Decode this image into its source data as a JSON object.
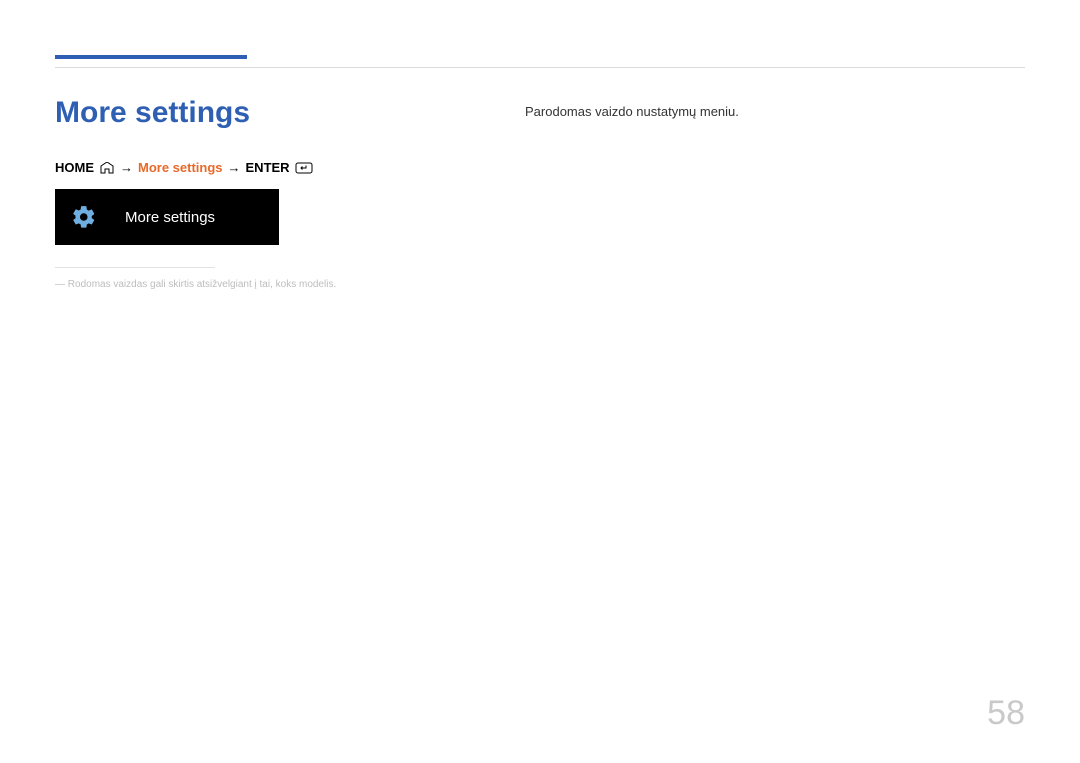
{
  "heading": "More settings",
  "breadcrumb": {
    "home": "HOME",
    "arrow": "→",
    "active": "More settings",
    "enter": "ENTER"
  },
  "tile": {
    "label": "More settings"
  },
  "note_prefix": "― ",
  "note": "Rodomas vaizdas gali skirtis atsižvelgiant į tai, koks modelis.",
  "body": "Parodomas vaizdo nustatymų meniu.",
  "page_number": "58"
}
